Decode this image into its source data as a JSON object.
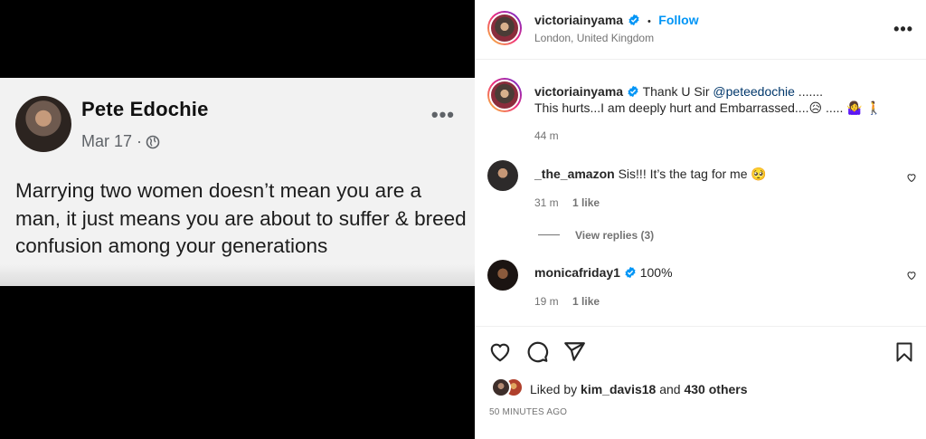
{
  "post_image": {
    "fb_name": "Pete Edochie",
    "fb_date": "Mar 17 ·",
    "fb_more": "•••",
    "fb_text": "Marrying two women doesn’t mean you are a man, it just means you are about to suffer & breed confusion among your generations"
  },
  "header": {
    "username": "victoriainyama",
    "separator": "•",
    "follow_label": "Follow",
    "location": "London, United Kingdom",
    "more": "•••"
  },
  "caption": {
    "username": "victoriainyama",
    "text_line1": "Thank U Sir ",
    "mention": "@peteedochie",
    "text_line1_end": " .......",
    "text_line2": "This hurts...I am deeply hurt and Embarrassed....😥 ..... 🤷‍♀️ 🚶",
    "time": "44 m"
  },
  "comments": [
    {
      "username": "_the_amazon",
      "text": "Sis!!! It’s the tag for me 🥺",
      "time": "31 m",
      "likes": "1 like",
      "view_replies": "View replies (3)"
    },
    {
      "username": "monicafriday1",
      "text": "100%",
      "time": "19 m",
      "likes": "1 like"
    }
  ],
  "likes": {
    "prefix": "Liked by ",
    "user": "kim_davis18",
    "middle": " and ",
    "others": "430 others"
  },
  "timestamp": "50 MINUTES AGO",
  "colors": {
    "link": "#0095f6",
    "mention": "#00376b",
    "muted": "#737373",
    "verified": "#0095f6"
  }
}
